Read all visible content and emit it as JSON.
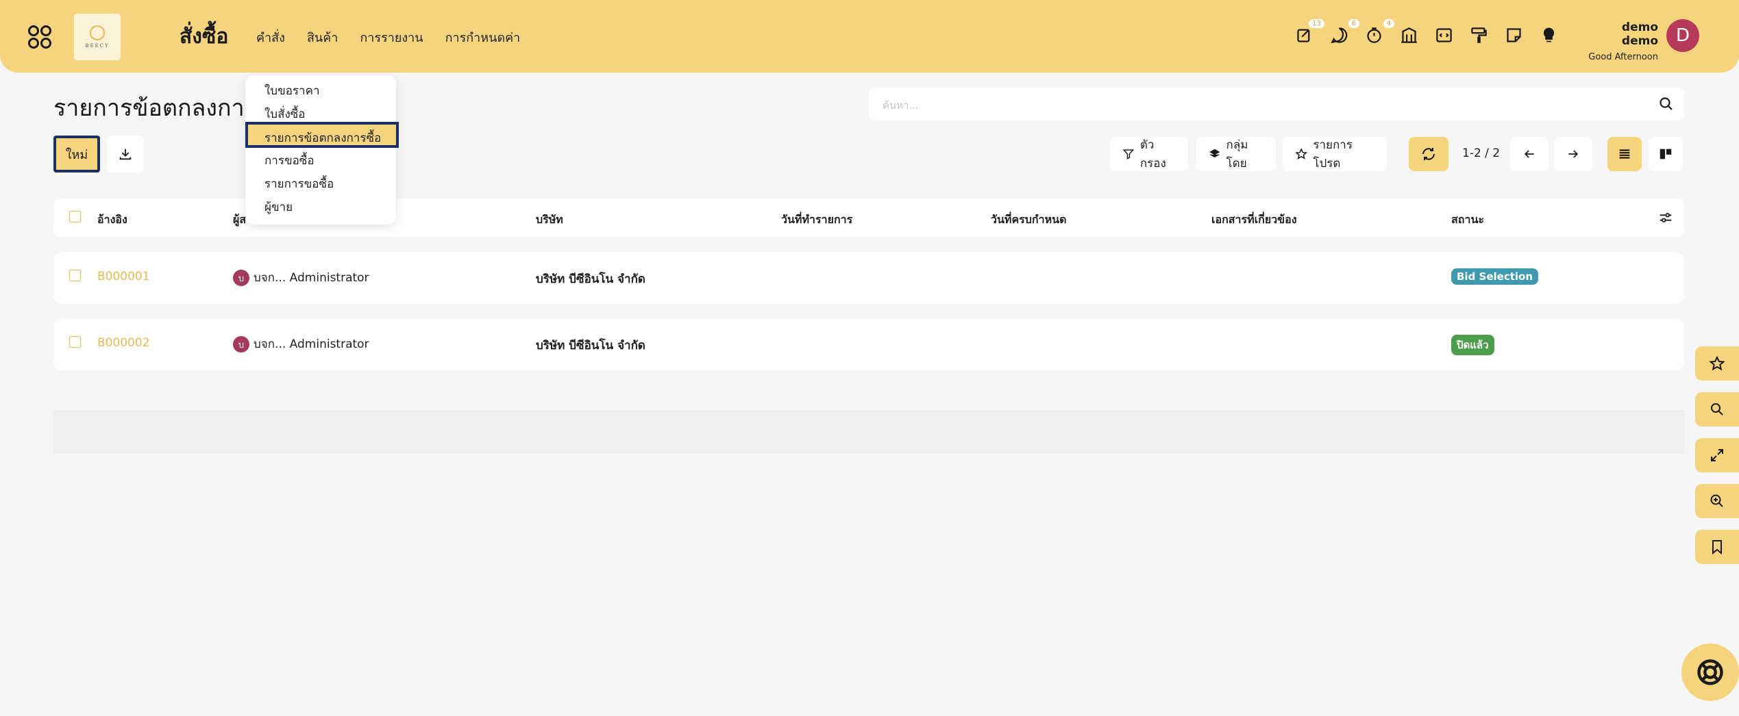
{
  "header": {
    "app_title": "สั่งซื้อ",
    "menu": [
      "คำสั่ง",
      "สินค้า",
      "การรายงาน",
      "การกำหนดค่า"
    ],
    "logo_text": "BEECY",
    "badges": {
      "activity": "13",
      "messages": "6",
      "timer": "4"
    },
    "user_name": "demo demo",
    "greeting": "Good Afternoon",
    "avatar_letter": "D"
  },
  "page": {
    "title": "รายการข้อตกลงการ",
    "search_placeholder": "ค้นหา...",
    "new_label": "ใหม่",
    "filter_label": "ตัวกรอง",
    "group_label": "กลุ่มโดย",
    "favorites_label": "รายการโปรด",
    "pager": "1-2 / 2"
  },
  "dropdown": {
    "items": [
      "ใบขอราคา",
      "ใบสั่งซื้อ",
      "รายการข้อตกลงการซื้อ",
      "การขอซื้อ",
      "รายการขอซื้อ",
      "ผู้ขาย"
    ]
  },
  "table": {
    "headers": [
      "อ้างอิง",
      "ผู้ส",
      "บริษัท",
      "วันที่ทำรายการ",
      "วันที่ครบกำหนด",
      "เอกสารที่เกี่ยวข้อง",
      "สถานะ"
    ],
    "rows": [
      {
        "ref": "B000001",
        "user_initial": "บ",
        "user": "บจก... Administrator",
        "company": "บริษัท บีซีอินโน จำกัด",
        "status": "Bid Selection",
        "status_color": "#3f9ab0"
      },
      {
        "ref": "B000002",
        "user_initial": "บ",
        "user": "บจก... Administrator",
        "company": "บริษัท บีซีอินโน จำกัด",
        "status": "ปิดแล้ว",
        "status_color": "#4e9d4b"
      }
    ]
  },
  "colors": {
    "accent": "#f6d47e",
    "focus_border": "#1b3166"
  }
}
